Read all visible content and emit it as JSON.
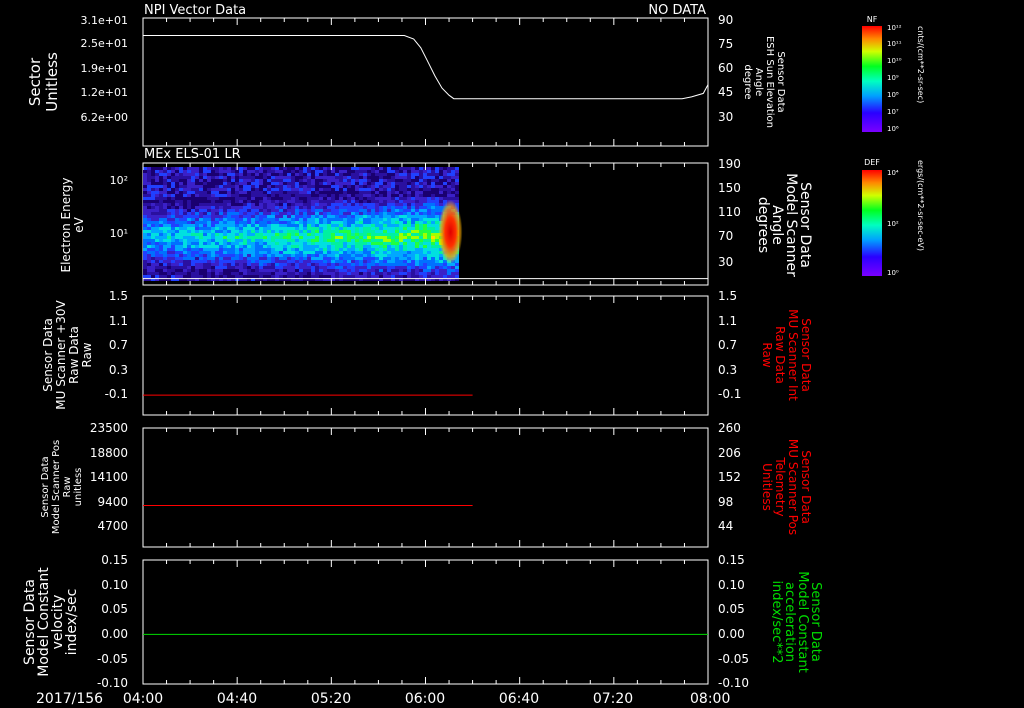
{
  "time": {
    "date_label": "2017/156",
    "tick_labels": [
      "04:00",
      "04:40",
      "05:20",
      "06:00",
      "06:40",
      "07:20",
      "08:00"
    ],
    "start_min": 240,
    "end_min": 480,
    "ticks_min": [
      240,
      280,
      320,
      360,
      400,
      440,
      480
    ]
  },
  "colors": {
    "background": "#000000",
    "axes": "#ffffff",
    "red_series": "#ff0000",
    "green_series": "#00dd00",
    "white_series": "#ffffff"
  },
  "colorbars": [
    {
      "header": "NF",
      "units": "cnts/(cm**2-sr-sec)",
      "ticks": [
        "10¹²",
        "10¹¹",
        "10¹⁰",
        "10⁹",
        "10⁸",
        "10⁷",
        "10⁶"
      ]
    },
    {
      "header": "DEF",
      "units": "ergs/(cm**2-sr-sec-eV)",
      "ticks": [
        "10⁴",
        "10²",
        "10⁰"
      ]
    }
  ],
  "chart_data": [
    {
      "type": "line",
      "panel": "sector",
      "title": "NPI Vector Data",
      "status": "NO DATA",
      "ylabel": [
        "Sector",
        "Unitless"
      ],
      "left_ticks": [
        "3.1e+01",
        "2.5e+01",
        "1.9e+01",
        "1.2e+01",
        "6.2e+00"
      ],
      "left_tick_values": [
        31,
        25,
        19,
        12,
        6.2
      ],
      "right_label": [
        "Sensor Data",
        "ESH Sun Elevation",
        "Angle",
        "degree"
      ],
      "right_ticks": [
        "90",
        "75",
        "60",
        "45",
        "30"
      ],
      "right_ylim": [
        17,
        90
      ],
      "series": [
        {
          "color": "#ffffff",
          "axis": "right",
          "x": [
            240,
            280,
            320,
            340,
            351,
            355,
            358,
            361,
            364,
            367,
            370,
            372,
            375,
            400,
            440,
            469,
            473,
            478,
            480
          ],
          "y": [
            80,
            80,
            80,
            80,
            80,
            78,
            73,
            65,
            57,
            50,
            46,
            44,
            44,
            44,
            44,
            44,
            45,
            47,
            52
          ]
        }
      ]
    },
    {
      "type": "heatmap",
      "panel": "els",
      "title": "MEx ELS-01 LR",
      "ylabel": [
        "Electron Energy",
        "eV"
      ],
      "left_ticks": [
        "10²",
        "10¹"
      ],
      "left_tick_values": [
        100,
        10
      ],
      "ylim_log": [
        1,
        200
      ],
      "right_label": [
        "Sensor Data",
        "Model Scanner",
        "Angle",
        "degrees"
      ],
      "right_ticks": [
        "190",
        "150",
        "110",
        "70",
        "30"
      ],
      "right_ylim": [
        0,
        190
      ],
      "data_x_range": [
        240,
        374
      ],
      "scanner_angle": {
        "color": "#ffffff",
        "x": [
          240,
          480
        ],
        "y": [
          10,
          10
        ]
      }
    },
    {
      "type": "line",
      "panel": "mu_int",
      "ylabel": [
        "Sensor Data",
        "MU Scanner +30V",
        "Raw Data",
        "Raw"
      ],
      "left_ticks": [
        "1.5",
        "1.1",
        "0.7",
        "0.3",
        "-0.1"
      ],
      "ylim": [
        -0.3,
        1.5
      ],
      "right_label": [
        "Sensor Data",
        "MU Scanner Int",
        "Raw Data",
        "Raw"
      ],
      "right_ticks": [
        "1.5",
        "1.1",
        "0.7",
        "0.3",
        "-0.1"
      ],
      "series": [
        {
          "color": "#ff0000",
          "x": [
            240,
            380
          ],
          "y": [
            0,
            0
          ]
        }
      ]
    },
    {
      "type": "line",
      "panel": "mu_pos",
      "ylabel": [
        "Sensor Data",
        "Model Scanner Pos",
        "Raw",
        "unitless"
      ],
      "left_ticks": [
        "23500",
        "18800",
        "14100",
        "9400",
        "4700"
      ],
      "ylim": [
        0,
        23500
      ],
      "right_label": [
        "Sensor Data",
        "MU Scanner Pos",
        "Telemetry",
        "Unitless"
      ],
      "right_ticks": [
        "260",
        "206",
        "152",
        "98",
        "44"
      ],
      "series": [
        {
          "color": "#ff0000",
          "x": [
            240,
            380
          ],
          "y": [
            8200,
            8200
          ]
        }
      ]
    },
    {
      "type": "line",
      "panel": "velocity",
      "ylabel": [
        "Sensor Data",
        "Model Constant",
        "velocity",
        "index/sec"
      ],
      "left_ticks": [
        "0.15",
        "0.10",
        "0.05",
        "0.00",
        "-0.05",
        "-0.10"
      ],
      "ylim": [
        -0.1,
        0.15
      ],
      "right_label": [
        "Sensor Data",
        "Model Constant",
        "acceleration",
        "index/sec**2"
      ],
      "right_ticks": [
        "0.15",
        "0.10",
        "0.05",
        "0.00",
        "-0.05",
        "-0.10"
      ],
      "series": [
        {
          "color": "#00dd00",
          "x": [
            240,
            480
          ],
          "y": [
            0,
            0
          ]
        }
      ]
    }
  ]
}
